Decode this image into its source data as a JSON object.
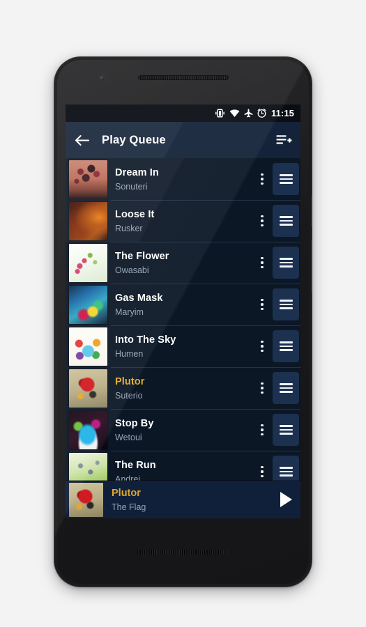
{
  "status_bar": {
    "time": "11:15",
    "icons": [
      "vibrate-icon",
      "wifi-icon",
      "airplane-mode-icon",
      "alarm-icon"
    ]
  },
  "toolbar": {
    "back_icon": "back-arrow-icon",
    "title": "Play Queue",
    "action_icon": "add-to-queue-icon"
  },
  "queue": {
    "rows": [
      {
        "title": "Dream In",
        "artist": "Sonuteri",
        "art": "art-tree",
        "accent": false
      },
      {
        "title": "Loose It",
        "artist": "Rusker",
        "art": "art-violin",
        "accent": false
      },
      {
        "title": "The Flower",
        "artist": "Owasabi",
        "art": "art-flower",
        "accent": false
      },
      {
        "title": "Gas Mask",
        "artist": "Maryim",
        "art": "art-gasmask",
        "accent": false
      },
      {
        "title": "Into The Sky",
        "artist": "Humen",
        "art": "art-rainbow",
        "accent": false
      },
      {
        "title": "Plutor",
        "artist": "Suterio",
        "art": "art-heart",
        "accent": true
      },
      {
        "title": "Stop By",
        "artist": "Wetoui",
        "art": "art-sneaker",
        "accent": false
      },
      {
        "title": "The Run",
        "artist": "Andrei",
        "art": "art-butterfly",
        "accent": false
      }
    ],
    "overflow_icon": "overflow-menu-icon",
    "drag_icon": "drag-handle-icon"
  },
  "now_playing": {
    "title": "Plutor",
    "artist": "The Flag",
    "art": "art-heart",
    "play_icon": "play-icon"
  },
  "colors": {
    "accent": "#e0a92e",
    "toolbar_bg": "#142339",
    "list_bg": "#0c1726",
    "nowplaying_bg": "#11203a",
    "divider": "#223248",
    "drag_button_bg": "#1c3050",
    "secondary_text": "#97a4b4",
    "primary_text": "#ffffff"
  }
}
